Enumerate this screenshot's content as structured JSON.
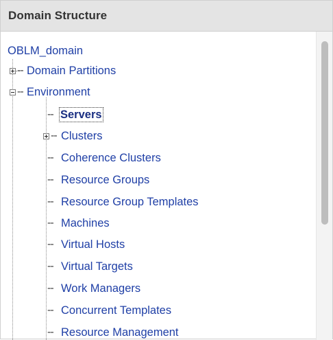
{
  "panel": {
    "title": "Domain Structure"
  },
  "tree": {
    "root": "OBLM_domain",
    "domain_partitions": "Domain Partitions",
    "environment": "Environment",
    "children": {
      "servers": "Servers",
      "clusters": "Clusters",
      "coherence_clusters": "Coherence Clusters",
      "resource_groups": "Resource Groups",
      "resource_group_templates": "Resource Group Templates",
      "machines": "Machines",
      "virtual_hosts": "Virtual Hosts",
      "virtual_targets": "Virtual Targets",
      "work_managers": "Work Managers",
      "concurrent_templates": "Concurrent Templates",
      "resource_management": "Resource Management"
    },
    "connector": "--"
  }
}
